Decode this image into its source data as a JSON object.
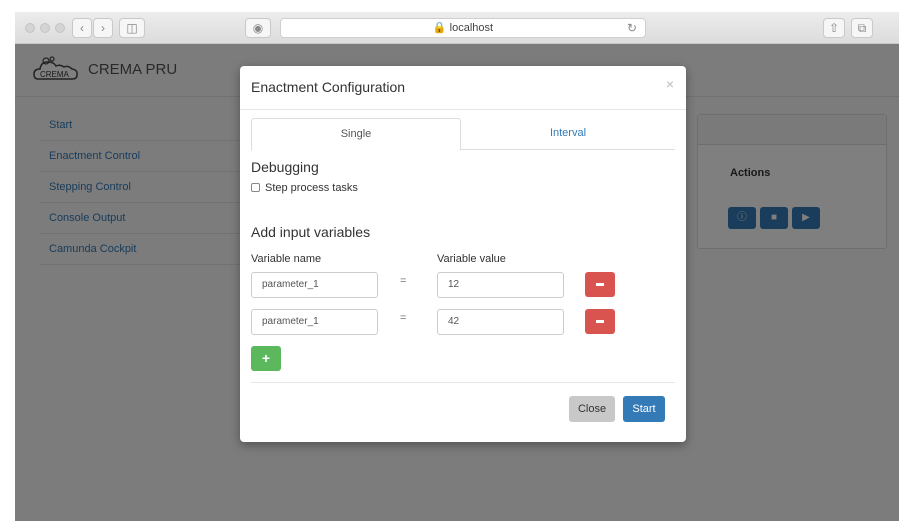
{
  "browser": {
    "url": "localhost",
    "lock_icon": "lock-icon"
  },
  "app": {
    "brand": "CREMA PRU",
    "logo_text": "CREMA",
    "sidebar": {
      "items": [
        {
          "label": "Start"
        },
        {
          "label": "Enactment Control"
        },
        {
          "label": "Stepping Control"
        },
        {
          "label": "Console Output"
        },
        {
          "label": "Camunda Cockpit"
        }
      ]
    },
    "panel": {
      "actions_label": "Actions"
    }
  },
  "modal": {
    "title": "Enactment Configuration",
    "close_glyph": "×",
    "tabs": [
      {
        "label": "Single",
        "active": true
      },
      {
        "label": "Interval",
        "active": false
      }
    ],
    "debugging_heading": "Debugging",
    "step_checkbox_label": "Step process tasks",
    "step_checkbox_checked": false,
    "variables_heading": "Add input variables",
    "col_name_label": "Variable name",
    "col_value_label": "Variable value",
    "equals": "=",
    "variables": [
      {
        "name": "parameter_1",
        "value": "12"
      },
      {
        "name": "parameter_1",
        "value": "42"
      }
    ],
    "add_glyph": "+",
    "close_button": "Close",
    "start_button": "Start"
  },
  "colors": {
    "primary": "#337ab7",
    "danger": "#d9534f",
    "success": "#5cb85c"
  }
}
